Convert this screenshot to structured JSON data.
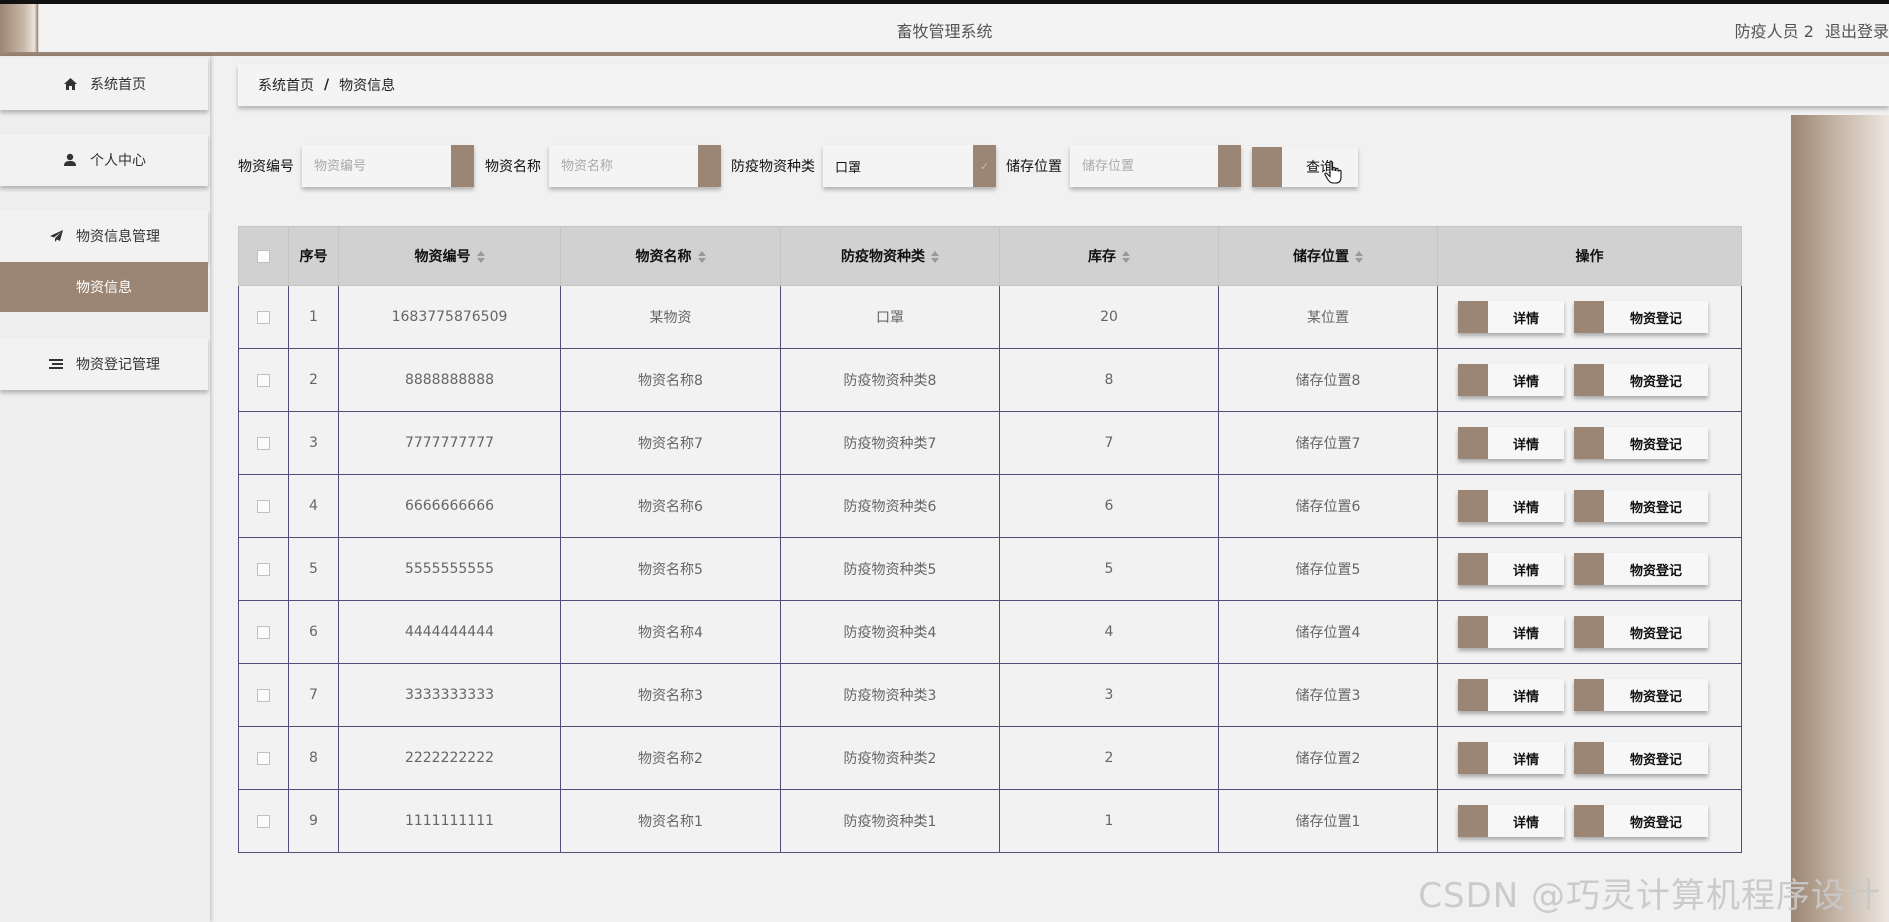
{
  "header": {
    "system_title": "畜牧管理系统",
    "user_label": "防疫人员 2",
    "logout_label": "退出登录"
  },
  "sidebar": {
    "items": [
      {
        "label": "系统首页",
        "icon": "home-icon"
      },
      {
        "label": "个人中心",
        "icon": "user-icon"
      },
      {
        "label": "物资信息管理",
        "icon": "send-icon"
      },
      {
        "label": "物资信息",
        "icon": ""
      },
      {
        "label": "物资登记管理",
        "icon": "list-icon"
      }
    ],
    "active_color": "#9b8574"
  },
  "breadcrumb": {
    "home": "系统首页",
    "separator": "/",
    "current": "物资信息"
  },
  "search": {
    "code_label": "物资编号",
    "code_placeholder": "物资编号",
    "name_label": "物资名称",
    "name_placeholder": "物资名称",
    "type_label": "防疫物资种类",
    "type_value": "口罩",
    "location_label": "储存位置",
    "location_placeholder": "储存位置",
    "query_button": "查询"
  },
  "table": {
    "headers": {
      "index": "序号",
      "code": "物资编号",
      "name": "物资名称",
      "type": "防疫物资种类",
      "stock": "库存",
      "location": "储存位置",
      "actions": "操作"
    },
    "detail_button": "详情",
    "register_button": "物资登记",
    "rows": [
      {
        "index": "1",
        "code": "1683775876509",
        "name": "某物资",
        "type": "口罩",
        "stock": "20",
        "location": "某位置"
      },
      {
        "index": "2",
        "code": "8888888888",
        "name": "物资名称8",
        "type": "防疫物资种类8",
        "stock": "8",
        "location": "储存位置8"
      },
      {
        "index": "3",
        "code": "7777777777",
        "name": "物资名称7",
        "type": "防疫物资种类7",
        "stock": "7",
        "location": "储存位置7"
      },
      {
        "index": "4",
        "code": "6666666666",
        "name": "物资名称6",
        "type": "防疫物资种类6",
        "stock": "6",
        "location": "储存位置6"
      },
      {
        "index": "5",
        "code": "5555555555",
        "name": "物资名称5",
        "type": "防疫物资种类5",
        "stock": "5",
        "location": "储存位置5"
      },
      {
        "index": "6",
        "code": "4444444444",
        "name": "物资名称4",
        "type": "防疫物资种类4",
        "stock": "4",
        "location": "储存位置4"
      },
      {
        "index": "7",
        "code": "3333333333",
        "name": "物资名称3",
        "type": "防疫物资种类3",
        "stock": "3",
        "location": "储存位置3"
      },
      {
        "index": "8",
        "code": "2222222222",
        "name": "物资名称2",
        "type": "防疫物资种类2",
        "stock": "2",
        "location": "储存位置2"
      },
      {
        "index": "9",
        "code": "1111111111",
        "name": "物资名称1",
        "type": "防疫物资种类1",
        "stock": "1",
        "location": "储存位置1"
      }
    ]
  },
  "watermark": "CSDN @巧灵计算机程序设计"
}
